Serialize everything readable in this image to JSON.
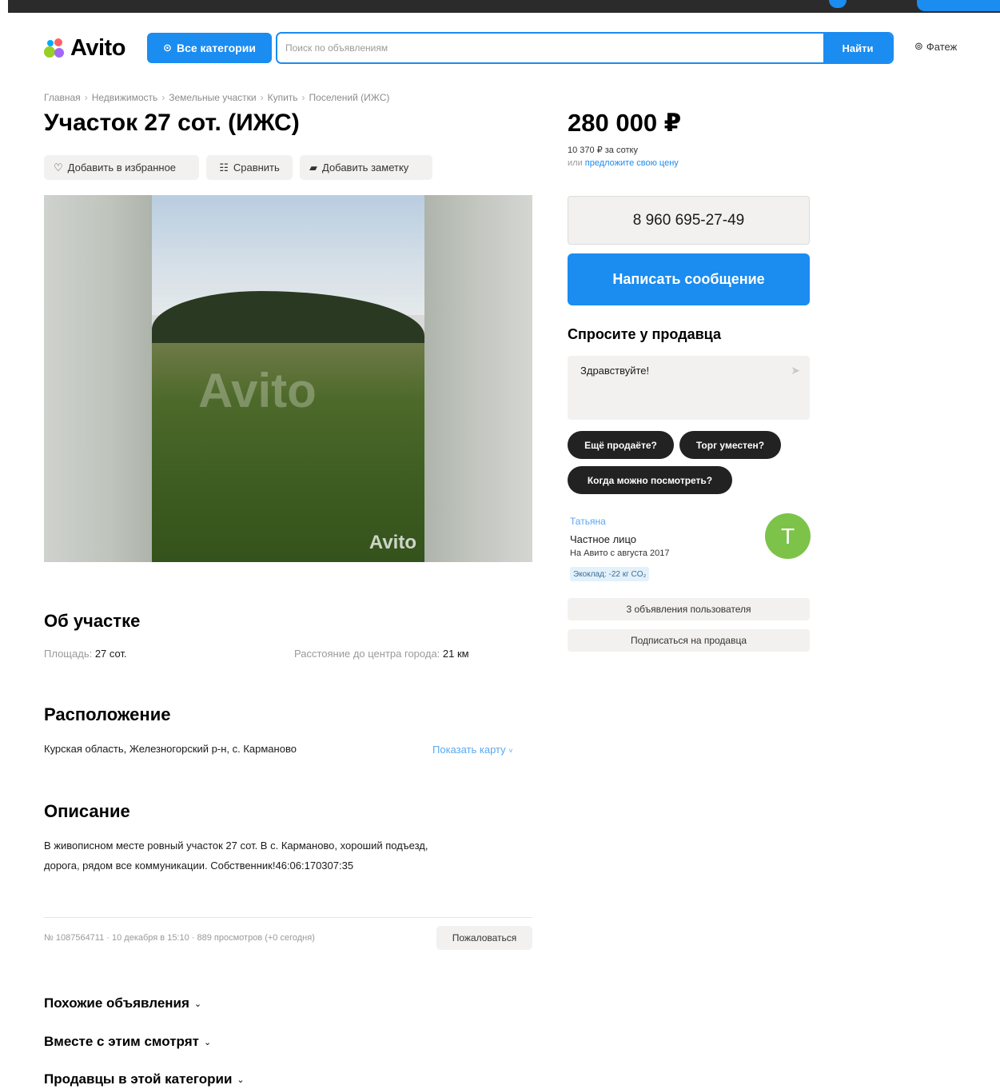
{
  "header": {
    "logo_text": "Avito",
    "categories_label": "Все категории",
    "search_placeholder": "Поиск по объявлениям",
    "search_button": "Найти",
    "location": "Фатеж"
  },
  "breadcrumb": [
    "Главная",
    "Недвижимость",
    "Земельные участки",
    "Купить",
    "Поселений (ИЖС)"
  ],
  "listing": {
    "title": "Участок 27 сот. (ИЖС)",
    "actions": {
      "favorite": "Добавить в избранное",
      "compare": "Сравнить",
      "note": "Добавить заметку"
    },
    "photo_watermark": "Avito"
  },
  "about": {
    "heading": "Об участке",
    "area_label": "Площадь:",
    "area_value": "27 сот.",
    "distance_label": "Расстояние до центра города:",
    "distance_value": "21 км"
  },
  "location_section": {
    "heading": "Расположение",
    "address": "Курская область, Железногорский р-н, с. Карманово",
    "map_link": "Показать карту"
  },
  "description": {
    "heading": "Описание",
    "line1": "В живописном месте ровный участок 27 сот. В с. Карманово, хороший подъезд,",
    "line2": "дорога, рядом все коммуникации. Собственник!46:06:170307:35"
  },
  "meta": {
    "info": "№ 1087564711 · 10 декабря в 15:10 · 889 просмотров (+0 сегодня)",
    "report": "Пожаловаться"
  },
  "collapsibles": {
    "similar": "Похожие объявления",
    "also_viewed": "Вместе с этим смотрят",
    "sellers": "Продавцы в этой категории"
  },
  "sidebar": {
    "price": "280 000 ₽",
    "price_per_unit": "10 370 ₽ за сотку",
    "offer_prefix": "или ",
    "offer_link": "предложите свою цену",
    "phone": "8 960 695-27-49",
    "message_button": "Написать сообщение",
    "ask_title": "Спросите у продавца",
    "ask_text": "Здравствуйте!",
    "quick_questions": [
      "Ещё продаёте?",
      "Торг уместен?",
      "Когда можно посмотреть?"
    ],
    "seller": {
      "name": "Татьяна",
      "type": "Частное лицо",
      "since": "На Авито с августа 2017",
      "eco": "Экоклад: -22 кг CO₂",
      "avatar_letter": "Т"
    },
    "user_listings": "3 объявления пользователя",
    "subscribe": "Подписаться на продавца"
  },
  "colors": {
    "accent": "#1b8cf0",
    "avatar": "#7dc34a",
    "chip": "#222222"
  }
}
